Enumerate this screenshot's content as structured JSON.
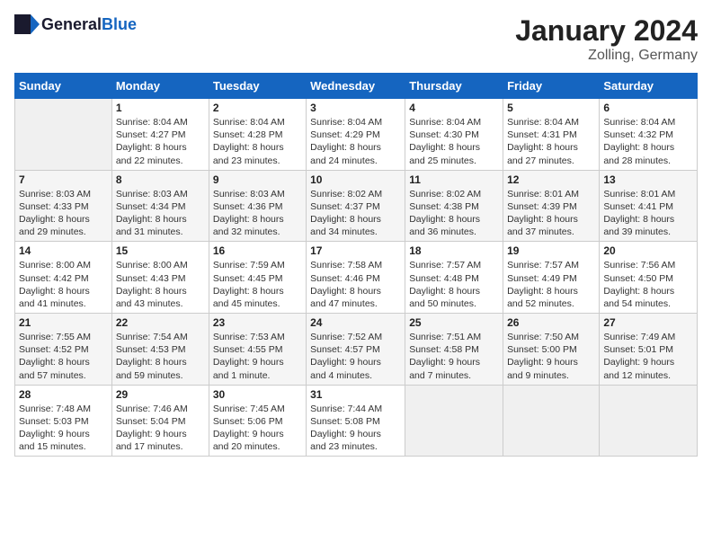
{
  "header": {
    "logo_general": "General",
    "logo_blue": "Blue",
    "title": "January 2024",
    "subtitle": "Zolling, Germany"
  },
  "calendar": {
    "weekdays": [
      "Sunday",
      "Monday",
      "Tuesday",
      "Wednesday",
      "Thursday",
      "Friday",
      "Saturday"
    ],
    "weeks": [
      [
        {
          "day": "",
          "info": ""
        },
        {
          "day": "1",
          "info": "Sunrise: 8:04 AM\nSunset: 4:27 PM\nDaylight: 8 hours\nand 22 minutes."
        },
        {
          "day": "2",
          "info": "Sunrise: 8:04 AM\nSunset: 4:28 PM\nDaylight: 8 hours\nand 23 minutes."
        },
        {
          "day": "3",
          "info": "Sunrise: 8:04 AM\nSunset: 4:29 PM\nDaylight: 8 hours\nand 24 minutes."
        },
        {
          "day": "4",
          "info": "Sunrise: 8:04 AM\nSunset: 4:30 PM\nDaylight: 8 hours\nand 25 minutes."
        },
        {
          "day": "5",
          "info": "Sunrise: 8:04 AM\nSunset: 4:31 PM\nDaylight: 8 hours\nand 27 minutes."
        },
        {
          "day": "6",
          "info": "Sunrise: 8:04 AM\nSunset: 4:32 PM\nDaylight: 8 hours\nand 28 minutes."
        }
      ],
      [
        {
          "day": "7",
          "info": "Sunrise: 8:03 AM\nSunset: 4:33 PM\nDaylight: 8 hours\nand 29 minutes."
        },
        {
          "day": "8",
          "info": "Sunrise: 8:03 AM\nSunset: 4:34 PM\nDaylight: 8 hours\nand 31 minutes."
        },
        {
          "day": "9",
          "info": "Sunrise: 8:03 AM\nSunset: 4:36 PM\nDaylight: 8 hours\nand 32 minutes."
        },
        {
          "day": "10",
          "info": "Sunrise: 8:02 AM\nSunset: 4:37 PM\nDaylight: 8 hours\nand 34 minutes."
        },
        {
          "day": "11",
          "info": "Sunrise: 8:02 AM\nSunset: 4:38 PM\nDaylight: 8 hours\nand 36 minutes."
        },
        {
          "day": "12",
          "info": "Sunrise: 8:01 AM\nSunset: 4:39 PM\nDaylight: 8 hours\nand 37 minutes."
        },
        {
          "day": "13",
          "info": "Sunrise: 8:01 AM\nSunset: 4:41 PM\nDaylight: 8 hours\nand 39 minutes."
        }
      ],
      [
        {
          "day": "14",
          "info": "Sunrise: 8:00 AM\nSunset: 4:42 PM\nDaylight: 8 hours\nand 41 minutes."
        },
        {
          "day": "15",
          "info": "Sunrise: 8:00 AM\nSunset: 4:43 PM\nDaylight: 8 hours\nand 43 minutes."
        },
        {
          "day": "16",
          "info": "Sunrise: 7:59 AM\nSunset: 4:45 PM\nDaylight: 8 hours\nand 45 minutes."
        },
        {
          "day": "17",
          "info": "Sunrise: 7:58 AM\nSunset: 4:46 PM\nDaylight: 8 hours\nand 47 minutes."
        },
        {
          "day": "18",
          "info": "Sunrise: 7:57 AM\nSunset: 4:48 PM\nDaylight: 8 hours\nand 50 minutes."
        },
        {
          "day": "19",
          "info": "Sunrise: 7:57 AM\nSunset: 4:49 PM\nDaylight: 8 hours\nand 52 minutes."
        },
        {
          "day": "20",
          "info": "Sunrise: 7:56 AM\nSunset: 4:50 PM\nDaylight: 8 hours\nand 54 minutes."
        }
      ],
      [
        {
          "day": "21",
          "info": "Sunrise: 7:55 AM\nSunset: 4:52 PM\nDaylight: 8 hours\nand 57 minutes."
        },
        {
          "day": "22",
          "info": "Sunrise: 7:54 AM\nSunset: 4:53 PM\nDaylight: 8 hours\nand 59 minutes."
        },
        {
          "day": "23",
          "info": "Sunrise: 7:53 AM\nSunset: 4:55 PM\nDaylight: 9 hours\nand 1 minute."
        },
        {
          "day": "24",
          "info": "Sunrise: 7:52 AM\nSunset: 4:57 PM\nDaylight: 9 hours\nand 4 minutes."
        },
        {
          "day": "25",
          "info": "Sunrise: 7:51 AM\nSunset: 4:58 PM\nDaylight: 9 hours\nand 7 minutes."
        },
        {
          "day": "26",
          "info": "Sunrise: 7:50 AM\nSunset: 5:00 PM\nDaylight: 9 hours\nand 9 minutes."
        },
        {
          "day": "27",
          "info": "Sunrise: 7:49 AM\nSunset: 5:01 PM\nDaylight: 9 hours\nand 12 minutes."
        }
      ],
      [
        {
          "day": "28",
          "info": "Sunrise: 7:48 AM\nSunset: 5:03 PM\nDaylight: 9 hours\nand 15 minutes."
        },
        {
          "day": "29",
          "info": "Sunrise: 7:46 AM\nSunset: 5:04 PM\nDaylight: 9 hours\nand 17 minutes."
        },
        {
          "day": "30",
          "info": "Sunrise: 7:45 AM\nSunset: 5:06 PM\nDaylight: 9 hours\nand 20 minutes."
        },
        {
          "day": "31",
          "info": "Sunrise: 7:44 AM\nSunset: 5:08 PM\nDaylight: 9 hours\nand 23 minutes."
        },
        {
          "day": "",
          "info": ""
        },
        {
          "day": "",
          "info": ""
        },
        {
          "day": "",
          "info": ""
        }
      ]
    ]
  }
}
